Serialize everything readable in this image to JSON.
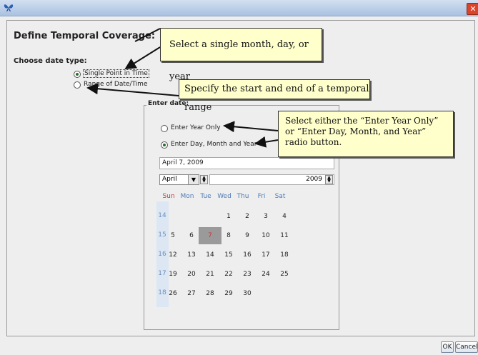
{
  "window": {
    "close_glyph": "✕",
    "app_icon": "butterfly-icon"
  },
  "form": {
    "heading": "Define Temporal Coverage:",
    "choose_label": "Choose date type:",
    "opt_single": "Single Point in Time",
    "opt_range": "Range of Date/Time",
    "enter_date_title": "Enter date:",
    "opt_year_only": "Enter Year Only",
    "opt_full": "Enter Day, Month and Year",
    "date_value": "April 7, 2009",
    "month": "April",
    "year": "2009"
  },
  "calendar": {
    "headers": [
      "Sun",
      "Mon",
      "Tue",
      "Wed",
      "Thu",
      "Fri",
      "Sat"
    ],
    "weeks": [
      {
        "num": "14",
        "days": [
          "",
          "",
          "",
          "1",
          "2",
          "3",
          "4"
        ]
      },
      {
        "num": "15",
        "days": [
          "5",
          "6",
          "7",
          "8",
          "9",
          "10",
          "11"
        ]
      },
      {
        "num": "16",
        "days": [
          "12",
          "13",
          "14",
          "15",
          "16",
          "17",
          "18"
        ]
      },
      {
        "num": "17",
        "days": [
          "19",
          "20",
          "21",
          "22",
          "23",
          "24",
          "25"
        ]
      },
      {
        "num": "18",
        "days": [
          "26",
          "27",
          "28",
          "29",
          "30",
          "",
          ""
        ]
      }
    ],
    "selected_day": "7"
  },
  "callouts": {
    "c1": "Select a single month, day, or year",
    "c2": "Specify the start and end of a temporal range",
    "c3": "Select either the “Enter Year Only” or “Enter Day, Month, and Year” radio button."
  },
  "buttons": {
    "ok": "OK",
    "cancel": "Cancel"
  }
}
